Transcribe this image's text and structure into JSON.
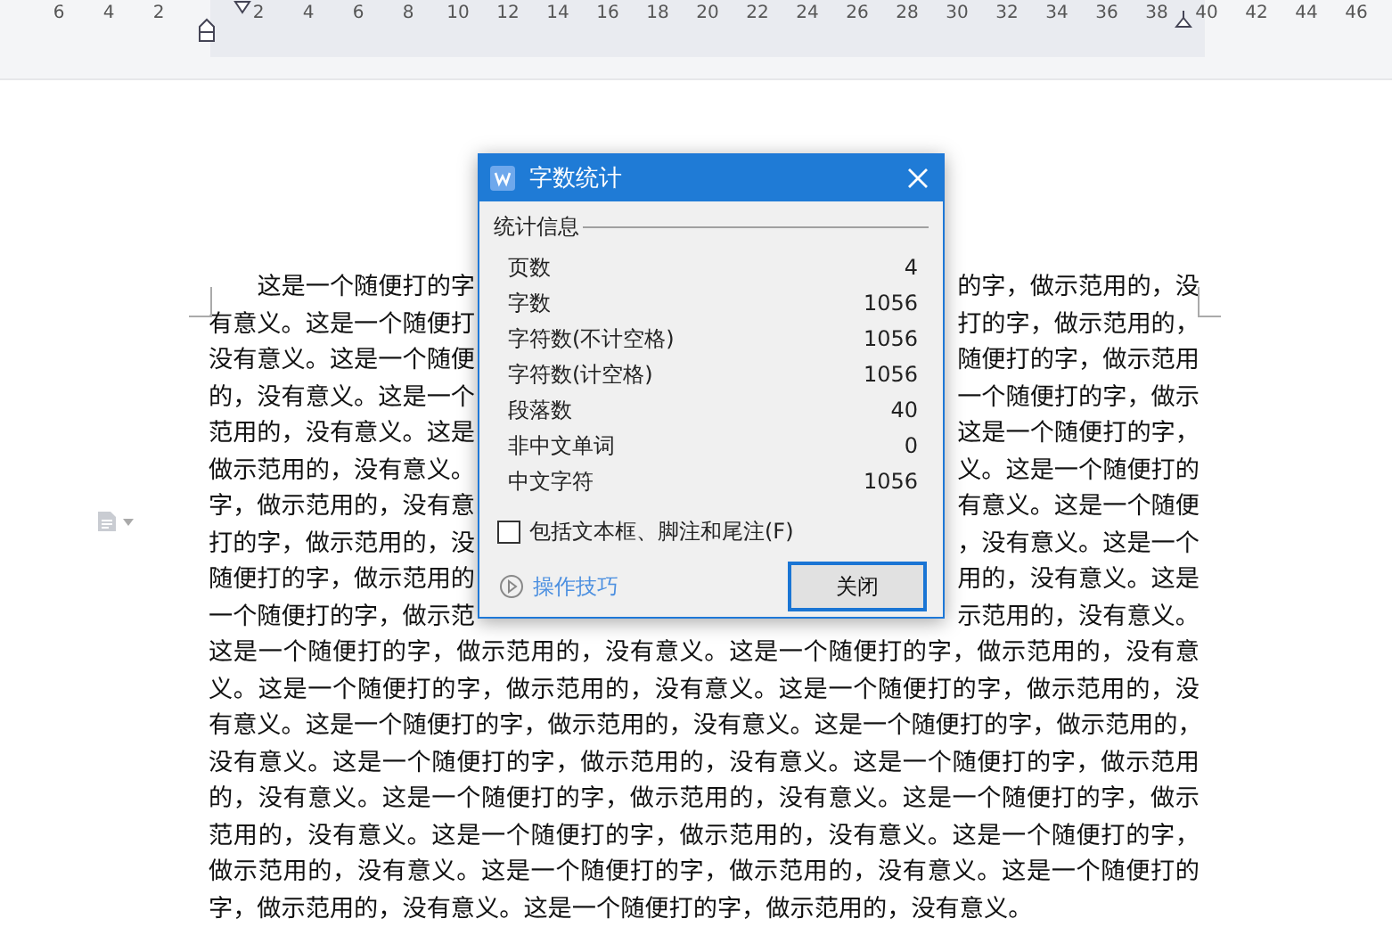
{
  "ruler": {
    "left_numbers": [
      "6",
      "4",
      "2"
    ],
    "right_numbers": [
      "2",
      "4",
      "6",
      "8",
      "10",
      "12",
      "14",
      "16",
      "18",
      "20",
      "22",
      "24",
      "26",
      "28",
      "30",
      "32",
      "34",
      "36",
      "38",
      "40",
      "42",
      "44",
      "46"
    ]
  },
  "document": {
    "lines": [
      {
        "left": "这是一个随便打的字",
        "right": "的字，做示范用的，没"
      },
      {
        "left": "有意义。这是一个随便打",
        "right": "打的字，做示范用的，"
      },
      {
        "left": "没有意义。这是一个随便",
        "right": "随便打的字，做示范用"
      },
      {
        "left": "的，没有意义。这是一个",
        "right": "一个随便打的字，做示"
      },
      {
        "left": "范用的，没有意义。这是",
        "right": "这是一个随便打的字，"
      },
      {
        "left": "做示范用的，没有意义。",
        "right": "义。这是一个随便打的"
      },
      {
        "left": "字，做示范用的，没有意",
        "right": "有意义。这是一个随便"
      },
      {
        "left": "打的字，做示范用的，没",
        "right": "，没有意义。这是一个"
      },
      {
        "left": "随便打的字，做示范用的",
        "right": "用的，没有意义。这是"
      },
      {
        "left": "一个随便打的字，做示范",
        "right": "示范用的，没有意义。"
      },
      {
        "text": "这是一个随便打的字，做示范用的，没有意义。这是一个随便打的字，做示范用的，没有意"
      },
      {
        "text": "义。这是一个随便打的字，做示范用的，没有意义。这是一个随便打的字，做示范用的，没"
      },
      {
        "text": "有意义。这是一个随便打的字，做示范用的，没有意义。这是一个随便打的字，做示范用的，"
      },
      {
        "text": "没有意义。这是一个随便打的字，做示范用的，没有意义。这是一个随便打的字，做示范用"
      },
      {
        "text": "的，没有意义。这是一个随便打的字，做示范用的，没有意义。这是一个随便打的字，做示"
      },
      {
        "text": "范用的，没有意义。这是一个随便打的字，做示范用的，没有意义。这是一个随便打的字，"
      },
      {
        "text": "做示范用的，没有意义。这是一个随便打的字，做示范用的，没有意义。这是一个随便打的"
      },
      {
        "text": "字，做示范用的，没有意义。这是一个随便打的字，做示范用的，没有意义。"
      }
    ]
  },
  "dialog": {
    "title": "字数统计",
    "section": "统计信息",
    "stats": [
      {
        "label": "页数",
        "value": "4"
      },
      {
        "label": "字数",
        "value": "1056"
      },
      {
        "label": "字符数(不计空格)",
        "value": "1056"
      },
      {
        "label": "字符数(计空格)",
        "value": "1056"
      },
      {
        "label": "段落数",
        "value": "40"
      },
      {
        "label": "非中文单词",
        "value": "0"
      },
      {
        "label": "中文字符",
        "value": "1056"
      }
    ],
    "checkbox": {
      "label": "包括文本框、脚注和尾注(F)",
      "checked": false
    },
    "tips_link": "操作技巧",
    "close_button": "关闭"
  }
}
